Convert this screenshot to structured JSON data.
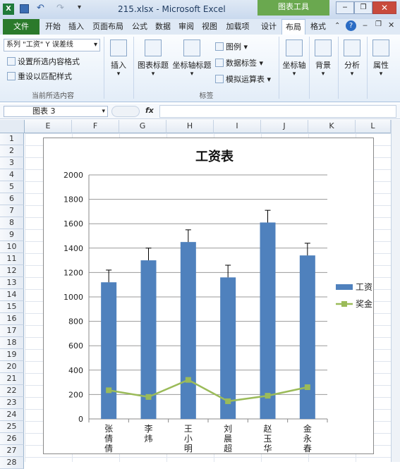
{
  "window": {
    "title": "215.xlsx - Microsoft Excel",
    "context_tab_title": "图表工具"
  },
  "tabs": [
    "文件",
    "开始",
    "插入",
    "页面布局",
    "公式",
    "数据",
    "审阅",
    "视图",
    "加载项",
    "设计",
    "布局",
    "格式"
  ],
  "active_tab": "布局",
  "ribbon": {
    "selection_dropdown": "系列 \"工资\" Y 误差线",
    "format_selection": "设置所选内容格式",
    "reset_style": "重设以匹配样式",
    "group_current_selection": "当前所选内容",
    "insert": "插入",
    "chart_title": "图表标题",
    "axis_titles": "坐标轴标题",
    "legend": "图例",
    "data_labels": "数据标签",
    "data_table": "模拟运算表",
    "group_labels": "标签",
    "axes": "坐标轴",
    "background": "背景",
    "analysis": "分析",
    "properties": "属性"
  },
  "formula_bar": {
    "name_box": "图表 3",
    "fx": "fx",
    "value": ""
  },
  "columns": [
    "E",
    "F",
    "G",
    "H",
    "I",
    "J",
    "K",
    "L"
  ],
  "rows": [
    "1",
    "2",
    "3",
    "4",
    "5",
    "6",
    "7",
    "8",
    "9",
    "10",
    "11",
    "12",
    "13",
    "14",
    "15",
    "16",
    "17",
    "18",
    "19",
    "20",
    "21",
    "22",
    "23",
    "24",
    "25",
    "26",
    "27",
    "28"
  ],
  "colors": {
    "bar": "#4f81bd",
    "line": "#9bbb59",
    "error_bar": "#000000"
  },
  "chart_data": {
    "type": "bar",
    "title": "工资表",
    "categories": [
      "张倩倩",
      "李炜",
      "王小明",
      "刘晨超",
      "赵玉华",
      "金永春"
    ],
    "ylim": [
      0,
      2000
    ],
    "yticks": [
      0,
      200,
      400,
      600,
      800,
      1000,
      1200,
      1400,
      1600,
      1800,
      2000
    ],
    "grid": true,
    "legend_position": "right",
    "series": [
      {
        "name": "工资",
        "kind": "bar",
        "values": [
          1120,
          1300,
          1450,
          1160,
          1610,
          1340
        ],
        "error_plus": [
          100,
          100,
          100,
          100,
          100,
          100
        ]
      },
      {
        "name": "奖金",
        "kind": "line",
        "values": [
          235,
          180,
          320,
          145,
          190,
          260
        ]
      }
    ]
  }
}
